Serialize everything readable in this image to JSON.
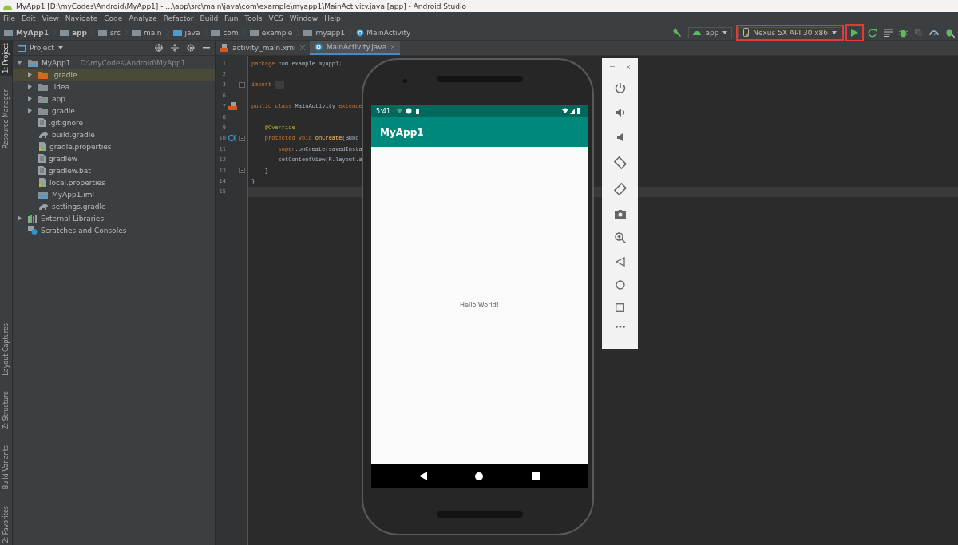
{
  "window": {
    "title": "MyApp1 [D:\\myCodes\\Android\\MyApp1] - ...\\app\\src\\main\\java\\com\\example\\myapp1\\MainActivity.java [app] - Android Studio"
  },
  "menu": [
    "File",
    "Edit",
    "View",
    "Navigate",
    "Code",
    "Analyze",
    "Refactor",
    "Build",
    "Run",
    "Tools",
    "VCS",
    "Window",
    "Help"
  ],
  "breadcrumbs": [
    {
      "label": "MyApp1",
      "kind": "module"
    },
    {
      "label": "app",
      "kind": "module"
    },
    {
      "label": "src",
      "kind": "folder"
    },
    {
      "label": "main",
      "kind": "folder"
    },
    {
      "label": "java",
      "kind": "source-folder"
    },
    {
      "label": "com",
      "kind": "package"
    },
    {
      "label": "example",
      "kind": "package"
    },
    {
      "label": "myapp1",
      "kind": "package"
    },
    {
      "label": "MainActivity",
      "kind": "class"
    }
  ],
  "toolbar": {
    "run_configuration": {
      "label": "app"
    },
    "device": {
      "label": "Nexus 5X API 30 x86",
      "highlighted": true
    },
    "run_button": {
      "highlighted": true
    }
  },
  "tool_windows_top": [
    {
      "label": "1: Project",
      "selected": true
    },
    {
      "label": "Resource Manager",
      "selected": false
    }
  ],
  "tool_windows_bottom": [
    {
      "label": "Layout Captures",
      "selected": false
    },
    {
      "label": "Z: Structure",
      "selected": false
    },
    {
      "label": "Build Variants",
      "selected": false
    },
    {
      "label": "2: Favorites",
      "selected": false
    }
  ],
  "project_panel": {
    "title": "Project"
  },
  "tree": [
    {
      "label": "MyApp1",
      "kind": "module",
      "path": "D:\\myCodes\\Android\\MyApp1",
      "expanded": true,
      "selected": false,
      "children": [
        {
          "label": ".gradle",
          "kind": "excluded-folder",
          "expanded": false,
          "selected": true
        },
        {
          "label": ".idea",
          "kind": "folder",
          "expanded": false,
          "selected": false
        },
        {
          "label": "app",
          "kind": "module-folder",
          "expanded": false,
          "selected": false
        },
        {
          "label": "gradle",
          "kind": "folder",
          "expanded": false,
          "selected": false
        },
        {
          "label": ".gitignore",
          "kind": "text-file",
          "selected": false
        },
        {
          "label": "build.gradle",
          "kind": "gradle-file",
          "selected": false
        },
        {
          "label": "gradle.properties",
          "kind": "properties-file",
          "selected": false
        },
        {
          "label": "gradlew",
          "kind": "text-file",
          "selected": false
        },
        {
          "label": "gradlew.bat",
          "kind": "text-file",
          "selected": false
        },
        {
          "label": "local.properties",
          "kind": "properties-file",
          "selected": false
        },
        {
          "label": "MyApp1.iml",
          "kind": "module-file",
          "selected": false
        },
        {
          "label": "settings.gradle",
          "kind": "gradle-file",
          "selected": false
        }
      ]
    },
    {
      "label": "External Libraries",
      "kind": "libraries",
      "expanded": false,
      "selected": false
    },
    {
      "label": "Scratches and Consoles",
      "kind": "scratches",
      "selected": false
    }
  ],
  "editor_tabs": [
    {
      "label": "activity_main.xml",
      "kind": "xml",
      "selected": false
    },
    {
      "label": "MainActivity.java",
      "kind": "class",
      "selected": true
    }
  ],
  "code_lines": [
    {
      "number": "1",
      "tokens": [
        {
          "text": "package ",
          "kind": "keyword"
        },
        {
          "text": "com.example.myapp1",
          "kind": "plain"
        },
        {
          "text": ";",
          "kind": "keyword"
        }
      ]
    },
    {
      "number": "2"
    },
    {
      "number": "3",
      "fold_marker": true,
      "folded": true,
      "tokens": [
        {
          "text": "import",
          "kind": "keyword"
        }
      ]
    },
    {
      "number": "6"
    },
    {
      "number": "7",
      "layout_link": true,
      "tokens": [
        {
          "text": "public class ",
          "kind": "keyword"
        },
        {
          "text": "MainActivity ",
          "kind": "plain"
        },
        {
          "text": "extende",
          "kind": "keyword"
        }
      ]
    },
    {
      "number": "8"
    },
    {
      "number": "9",
      "tokens": [
        {
          "text": "    @Override",
          "kind": "annotation"
        }
      ]
    },
    {
      "number": "10",
      "override_marker": true,
      "fold_marker": true,
      "tokens": [
        {
          "text": "    protected void ",
          "kind": "keyword"
        },
        {
          "text": "onCreate",
          "kind": "method"
        },
        {
          "text": "(Bund",
          "kind": "plain"
        }
      ]
    },
    {
      "number": "11",
      "tokens": [
        {
          "text": "        super",
          "kind": "keyword"
        },
        {
          "text": ".onCreate(savedInsta",
          "kind": "plain"
        }
      ]
    },
    {
      "number": "12",
      "tokens": [
        {
          "text": "        setContentView(R.layout.a",
          "kind": "plain"
        }
      ]
    },
    {
      "number": "13",
      "fold_marker": true,
      "tokens": [
        {
          "text": "    }",
          "kind": "plain"
        }
      ]
    },
    {
      "number": "14",
      "tokens": [
        {
          "text": "}",
          "kind": "plain"
        }
      ]
    },
    {
      "number": "15",
      "current": true
    }
  ],
  "emulator": {
    "status_time": "5:41",
    "app_title": "MyApp1",
    "content_text": "Hello World!"
  }
}
